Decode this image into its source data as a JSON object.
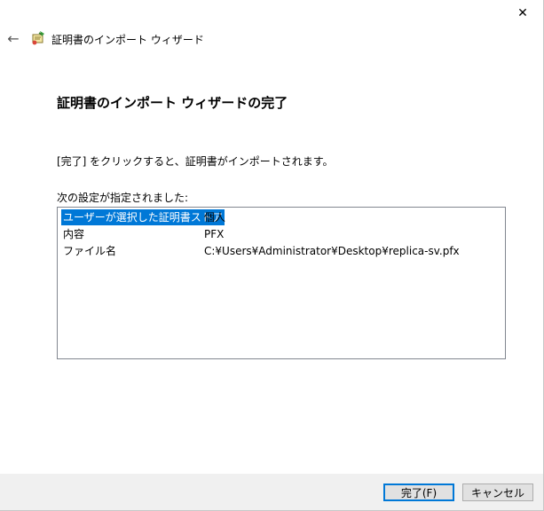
{
  "window": {
    "title": "証明書のインポート ウィザード",
    "close_glyph": "✕",
    "back_glyph": "←"
  },
  "main": {
    "heading": "証明書のインポート ウィザードの完了",
    "description": "[完了] をクリックすると、証明書がインポートされます。",
    "settings_label": "次の設定が指定されました:",
    "settings": [
      {
        "key": "ユーザーが選択した証明書ストア",
        "value": "個人",
        "selected": true
      },
      {
        "key": "内容",
        "value": "PFX",
        "selected": false
      },
      {
        "key": "ファイル名",
        "value": "C:¥Users¥Administrator¥Desktop¥replica-sv.pfx",
        "selected": false
      }
    ]
  },
  "footer": {
    "finish_label": "完了(F)",
    "cancel_label": "キャンセル"
  },
  "colors": {
    "selection": "#0078d7",
    "footer_bg": "#f0f0f0"
  },
  "icons": [
    "close-icon",
    "back-arrow-icon",
    "certificate-wizard-icon"
  ]
}
